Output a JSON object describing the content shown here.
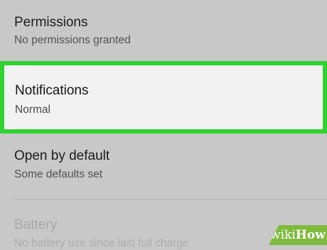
{
  "settings": {
    "items": [
      {
        "title": "Permissions",
        "subtitle": "No permissions granted"
      },
      {
        "title": "Notifications",
        "subtitle": "Normal"
      },
      {
        "title": "Open by default",
        "subtitle": "Some defaults set"
      },
      {
        "title": "Battery",
        "subtitle": "No battery use since last full charge"
      }
    ]
  },
  "highlight_color": "#2fd32f",
  "watermark": {
    "prefix": "wiki",
    "suffix": "How"
  }
}
